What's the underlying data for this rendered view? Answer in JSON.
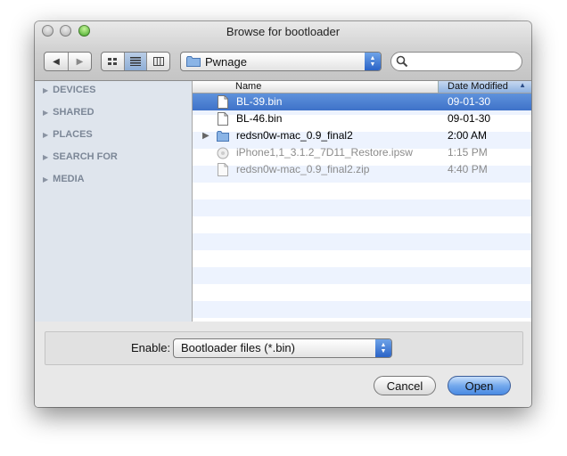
{
  "window": {
    "title": "Browse for bootloader"
  },
  "toolbar": {
    "back_glyph": "◀",
    "forward_glyph": "▶",
    "view_modes": [
      "icon-view",
      "list-view",
      "column-view"
    ],
    "active_view": "list-view",
    "location": "Pwnage",
    "search_value": ""
  },
  "sidebar": {
    "items": [
      {
        "label": "DEVICES"
      },
      {
        "label": "SHARED"
      },
      {
        "label": "PLACES"
      },
      {
        "label": "SEARCH FOR"
      },
      {
        "label": "MEDIA"
      }
    ]
  },
  "list": {
    "headers": {
      "name": "Name",
      "date": "Date Modified"
    },
    "rows": [
      {
        "name": "BL-39.bin",
        "date": "09-01-30",
        "icon": "document-icon",
        "selected": true,
        "dim": false
      },
      {
        "name": "BL-46.bin",
        "date": "09-01-30",
        "icon": "document-icon",
        "selected": false,
        "dim": false
      },
      {
        "name": "redsn0w-mac_0.9_final2",
        "date": "2:00 AM",
        "icon": "folder-icon",
        "selected": false,
        "dim": false
      },
      {
        "name": "iPhone1,1_3.1.2_7D11_Restore.ipsw",
        "date": "1:15 PM",
        "icon": "ipsw-icon",
        "selected": false,
        "dim": true
      },
      {
        "name": "redsn0w-mac_0.9_final2.zip",
        "date": "4:40 PM",
        "icon": "zip-icon",
        "selected": false,
        "dim": true
      }
    ]
  },
  "accessory": {
    "enable_label": "Enable:",
    "filter_value": "Bootloader files (*.bin)"
  },
  "buttons": {
    "cancel": "Cancel",
    "open": "Open"
  },
  "colors": {
    "selection": "#3e72c9",
    "sidebar_bg": "#dfe5ed",
    "zoom_button": "#2e9b15"
  }
}
